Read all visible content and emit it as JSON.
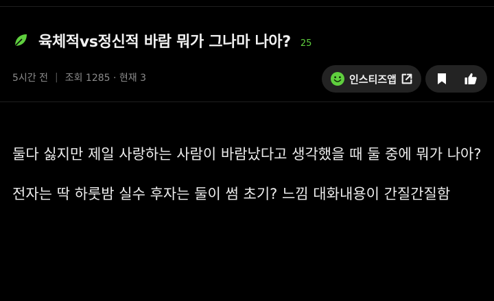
{
  "post": {
    "title": "육체적vs정신적 바람 뭐가 그나마 나아?",
    "comment_count": "25",
    "time": "5시간 전",
    "views": "조회 1285 · 현재 3",
    "title_icon": "leaf-icon"
  },
  "actions": {
    "insti_label": "인스티즈앱",
    "insti_icon": "smile-icon",
    "external_icon": "external-link-icon",
    "bookmark_icon": "bookmark-icon",
    "like_icon": "thumbs-up-icon"
  },
  "content": {
    "paragraphs": [
      "둘다 싫지만 제일 사랑하는 사람이 바람났다고 생각했을 때 둘 중에 뭐가 나아?",
      "전자는 딱 하룻밤 실수 후자는 둘이 썸 초기? 느낌 대화내용이 간질간질함"
    ]
  },
  "colors": {
    "background": "#000000",
    "accent_green": "#5fcf3e",
    "pill_bg": "#232323",
    "meta_text": "#8c8c8c"
  }
}
